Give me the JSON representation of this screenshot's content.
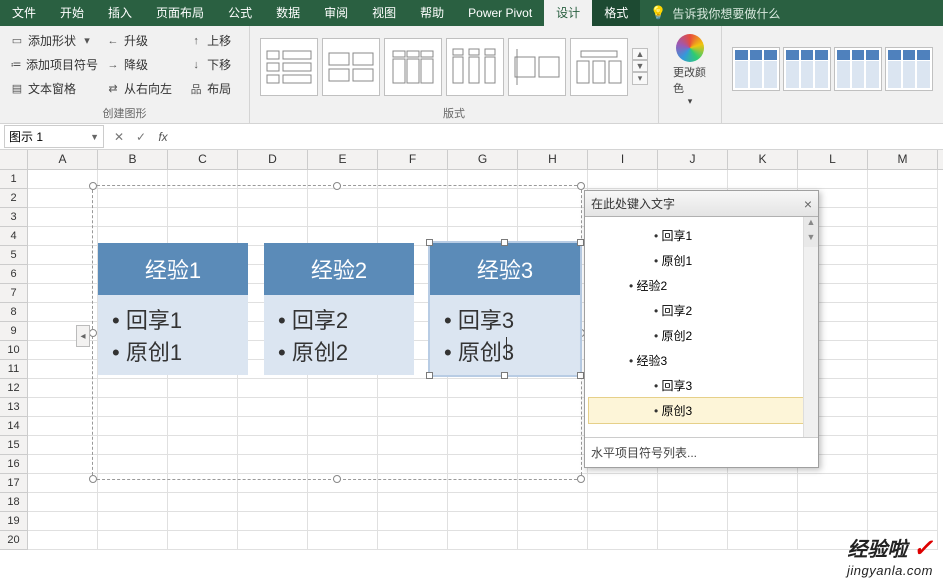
{
  "menu": {
    "items": [
      "文件",
      "开始",
      "插入",
      "页面布局",
      "公式",
      "数据",
      "审阅",
      "视图",
      "帮助",
      "Power Pivot"
    ],
    "context": [
      "设计",
      "格式"
    ],
    "search_placeholder": "告诉我你想要做什么"
  },
  "ribbon": {
    "shapes": {
      "add_shape": "添加形状",
      "add_bullet": "添加项目符号",
      "text_pane": "文本窗格",
      "promote": "升级",
      "demote": "降级",
      "rtl": "从右向左",
      "move_up": "上移",
      "move_down": "下移",
      "layout": "布局",
      "group_label": "创建图形"
    },
    "layouts_label": "版式",
    "change_colors": "更改颜色"
  },
  "namebox": "图示 1",
  "columns": [
    "A",
    "B",
    "C",
    "D",
    "E",
    "F",
    "G",
    "H",
    "I",
    "J",
    "K",
    "L",
    "M"
  ],
  "rows": [
    "1",
    "2",
    "3",
    "4",
    "5",
    "6",
    "7",
    "8",
    "9",
    "10",
    "11",
    "12",
    "13",
    "14",
    "15",
    "16",
    "17",
    "18",
    "19",
    "20"
  ],
  "smartart": {
    "cards": [
      {
        "title": "经验1",
        "items": [
          "回享1",
          "原创1"
        ]
      },
      {
        "title": "经验2",
        "items": [
          "回享2",
          "原创2"
        ]
      },
      {
        "title": "经验3",
        "items": [
          "回享3",
          "原创3"
        ]
      }
    ]
  },
  "textpane": {
    "title": "在此处键入文字",
    "outline": [
      {
        "lvl": 2,
        "t": "回享1"
      },
      {
        "lvl": 2,
        "t": "原创1"
      },
      {
        "lvl": 1,
        "t": "经验2"
      },
      {
        "lvl": 2,
        "t": "回享2"
      },
      {
        "lvl": 2,
        "t": "原创2"
      },
      {
        "lvl": 1,
        "t": "经验3"
      },
      {
        "lvl": 2,
        "t": "回享3"
      },
      {
        "lvl": 2,
        "t": "原创3",
        "sel": true
      }
    ],
    "footer": "水平项目符号列表..."
  },
  "watermark": {
    "brand": "经验啦",
    "url": "jingyanla.com"
  }
}
